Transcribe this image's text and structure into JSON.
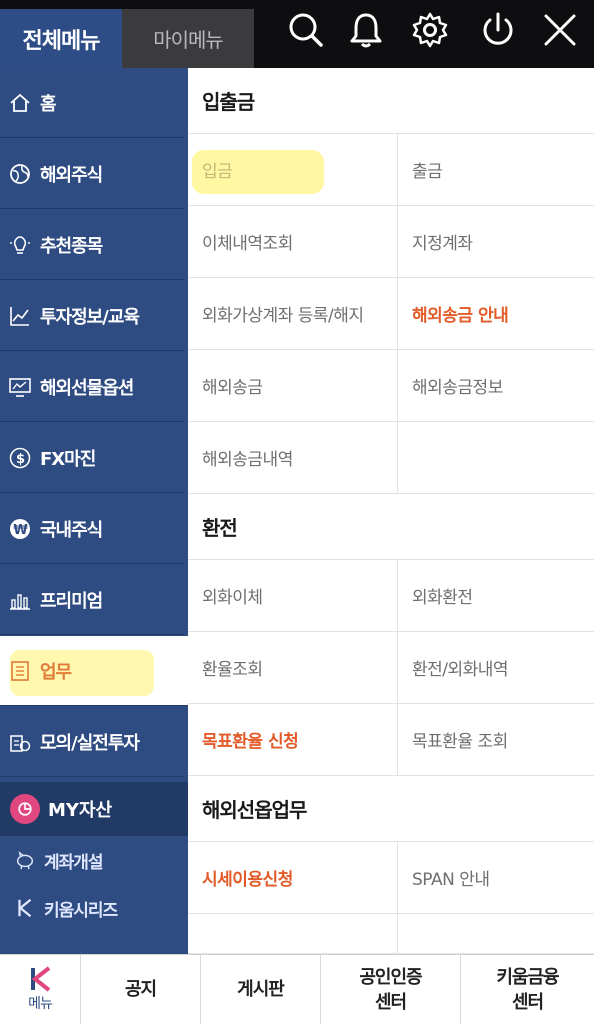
{
  "header": {
    "tab_all": "전체메뉴",
    "tab_my": "마이메뉴",
    "icons": [
      "search-icon",
      "bell-icon",
      "gear-icon",
      "power-icon",
      "close-icon"
    ]
  },
  "sidebar": {
    "items": [
      {
        "label": "홈",
        "icon": "home-icon"
      },
      {
        "label": "해외주식",
        "icon": "globe-icon"
      },
      {
        "label": "추천종목",
        "icon": "bulb-icon"
      },
      {
        "label": "투자정보/교육",
        "icon": "chart-line-icon"
      },
      {
        "label": "해외선물옵션",
        "icon": "monitor-chart-icon"
      },
      {
        "label": "FX마진",
        "icon": "dollar-icon"
      },
      {
        "label": "국내주식",
        "icon": "won-icon"
      },
      {
        "label": "프리미엄",
        "icon": "bar-chart-icon"
      },
      {
        "label": "업무",
        "icon": "document-icon"
      },
      {
        "label": "모의/실전투자",
        "icon": "coin-stack-icon"
      }
    ],
    "my_asset": "MY자산",
    "sub": [
      {
        "label": "계좌개설",
        "icon": "piggy-bank-icon"
      },
      {
        "label": "키움시리즈",
        "icon": "kiwoom-k-icon"
      }
    ]
  },
  "content": {
    "sections": [
      {
        "title": "입출금",
        "rows": [
          [
            "입금",
            "출금"
          ],
          [
            "이체내역조회",
            "지정계좌"
          ],
          [
            "외화가상계좌 등록/해지",
            "해외송금 안내"
          ],
          [
            "해외송금",
            "해외송금정보"
          ],
          [
            "해외송금내역",
            ""
          ]
        ]
      },
      {
        "title": "환전",
        "rows": [
          [
            "외화이체",
            "외화환전"
          ],
          [
            "환율조회",
            "환전/외화내역"
          ],
          [
            "목표환율 신청",
            "목표환율 조회"
          ]
        ]
      },
      {
        "title": "해외선옵업무",
        "rows": [
          [
            "시세이용신청",
            "SPAN 안내"
          ]
        ]
      }
    ],
    "accent_color": "#e25b28"
  },
  "bottom": {
    "menu_label": "메뉴",
    "notice": "공지",
    "board": "게시판",
    "cert_line1": "공인인증",
    "cert_line2": "센터",
    "kiwoom_line1": "키움금융",
    "kiwoom_line2": "센터"
  },
  "colors": {
    "sidebar": "#2e4b82",
    "topbar": "#0e0e10",
    "highlight": "#fff36e"
  }
}
